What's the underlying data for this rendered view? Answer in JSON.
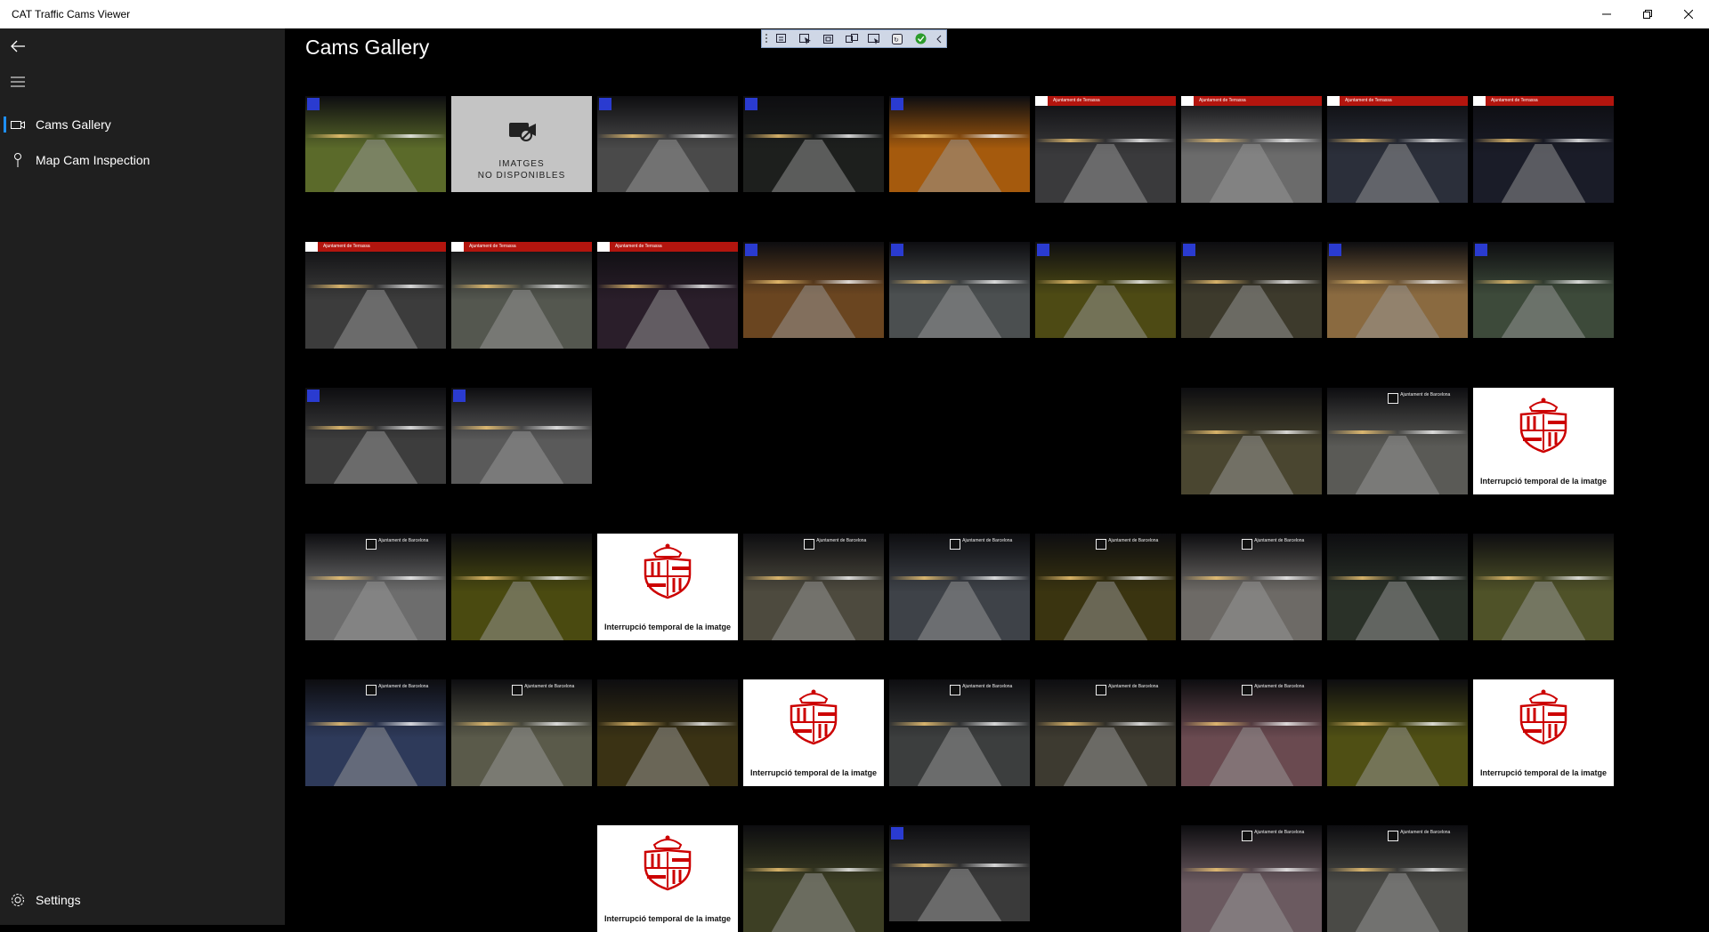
{
  "window": {
    "title": "CAT Traffic Cams Viewer",
    "controls": [
      "minimize",
      "restore",
      "close"
    ]
  },
  "sidebar": {
    "items": [
      {
        "label": "Cams Gallery",
        "icon": "camera-icon",
        "selected": true
      },
      {
        "label": "Map Cam Inspection",
        "icon": "map-pin-icon",
        "selected": false
      }
    ],
    "settings_label": "Settings",
    "accent": "#1e90ff"
  },
  "page": {
    "title": "Cams Gallery"
  },
  "placeholder": {
    "unavailable_line1": "IMATGES",
    "unavailable_line2": "NO DISPONIBLES",
    "interruption": "Interrupció temporal de la imatge"
  },
  "captions": {
    "bcn": "Ajuntament de Barcelona",
    "terrassa": "Ajuntament de Terrassa"
  },
  "gallery": [
    {
      "kind": "cam",
      "tone": "#5b6a2a",
      "style": "gencat"
    },
    {
      "kind": "unavailable"
    },
    {
      "kind": "cam",
      "tone": "#4a4a4a",
      "style": "gencat"
    },
    {
      "kind": "cam",
      "tone": "#1d1f1d",
      "style": "gencat"
    },
    {
      "kind": "cam",
      "tone": "#a55a0d",
      "style": "gencat"
    },
    {
      "kind": "cam",
      "tone": "#3a3a3c",
      "style": "terrassa"
    },
    {
      "kind": "cam",
      "tone": "#6b6b6b",
      "style": "terrassa"
    },
    {
      "kind": "cam",
      "tone": "#2b2f3a",
      "style": "terrassa"
    },
    {
      "kind": "cam",
      "tone": "#1a1c28",
      "style": "terrassa"
    },
    {
      "kind": "cam",
      "tone": "#3c3c3c",
      "style": "terrassa"
    },
    {
      "kind": "cam",
      "tone": "#54574f",
      "style": "terrassa"
    },
    {
      "kind": "cam",
      "tone": "#2a1e2a",
      "style": "terrassa"
    },
    {
      "kind": "cam",
      "tone": "#6a4520",
      "style": "gencat"
    },
    {
      "kind": "cam",
      "tone": "#4b4f50",
      "style": "gencat"
    },
    {
      "kind": "cam",
      "tone": "#4d4a14",
      "style": "gencat"
    },
    {
      "kind": "cam",
      "tone": "#3d3a2c",
      "style": "gencat"
    },
    {
      "kind": "cam",
      "tone": "#8a6a40",
      "style": "gencat"
    },
    {
      "kind": "cam",
      "tone": "#3d4a3a",
      "style": "gencat"
    },
    {
      "kind": "cam",
      "tone": "#3d3d3d",
      "style": "gencat"
    },
    {
      "kind": "cam",
      "tone": "#5a5a5a",
      "style": "gencat"
    },
    {
      "kind": "empty"
    },
    {
      "kind": "empty"
    },
    {
      "kind": "empty"
    },
    {
      "kind": "empty"
    },
    {
      "kind": "cam",
      "tone": "#4a4630",
      "style": "plain"
    },
    {
      "kind": "cam",
      "tone": "#5a5a56",
      "style": "bcn"
    },
    {
      "kind": "interrupt"
    },
    {
      "kind": "cam",
      "tone": "#6d6d6d",
      "style": "bcn"
    },
    {
      "kind": "cam",
      "tone": "#4a4a10",
      "style": "plain"
    },
    {
      "kind": "interrupt"
    },
    {
      "kind": "cam",
      "tone": "#4d4a3e",
      "style": "bcn"
    },
    {
      "kind": "cam",
      "tone": "#3e4248",
      "style": "bcn"
    },
    {
      "kind": "cam",
      "tone": "#3a3410",
      "style": "bcn"
    },
    {
      "kind": "cam",
      "tone": "#6d6a66",
      "style": "bcn"
    },
    {
      "kind": "cam",
      "tone": "#2a3128",
      "style": "plain"
    },
    {
      "kind": "cam",
      "tone": "#4f5228",
      "style": "plain"
    },
    {
      "kind": "cam",
      "tone": "#2e3a5a",
      "style": "bcn"
    },
    {
      "kind": "cam",
      "tone": "#5a5a4a",
      "style": "bcn"
    },
    {
      "kind": "cam",
      "tone": "#3a3214",
      "style": "plain"
    },
    {
      "kind": "interrupt"
    },
    {
      "kind": "cam",
      "tone": "#3c3e3e",
      "style": "bcn"
    },
    {
      "kind": "cam",
      "tone": "#3d3a30",
      "style": "bcn"
    },
    {
      "kind": "cam",
      "tone": "#6a4a50",
      "style": "bcn"
    },
    {
      "kind": "cam",
      "tone": "#4f4f14",
      "style": "plain"
    },
    {
      "kind": "interrupt"
    },
    {
      "kind": "empty"
    },
    {
      "kind": "empty"
    },
    {
      "kind": "interrupt"
    },
    {
      "kind": "cam",
      "tone": "#3d3f24",
      "style": "plain"
    },
    {
      "kind": "cam",
      "tone": "#3a3a3a",
      "style": "gencat"
    },
    {
      "kind": "empty"
    },
    {
      "kind": "cam",
      "tone": "#6b5a60",
      "style": "bcn"
    },
    {
      "kind": "cam",
      "tone": "#4a4a46",
      "style": "bcn"
    }
  ]
}
